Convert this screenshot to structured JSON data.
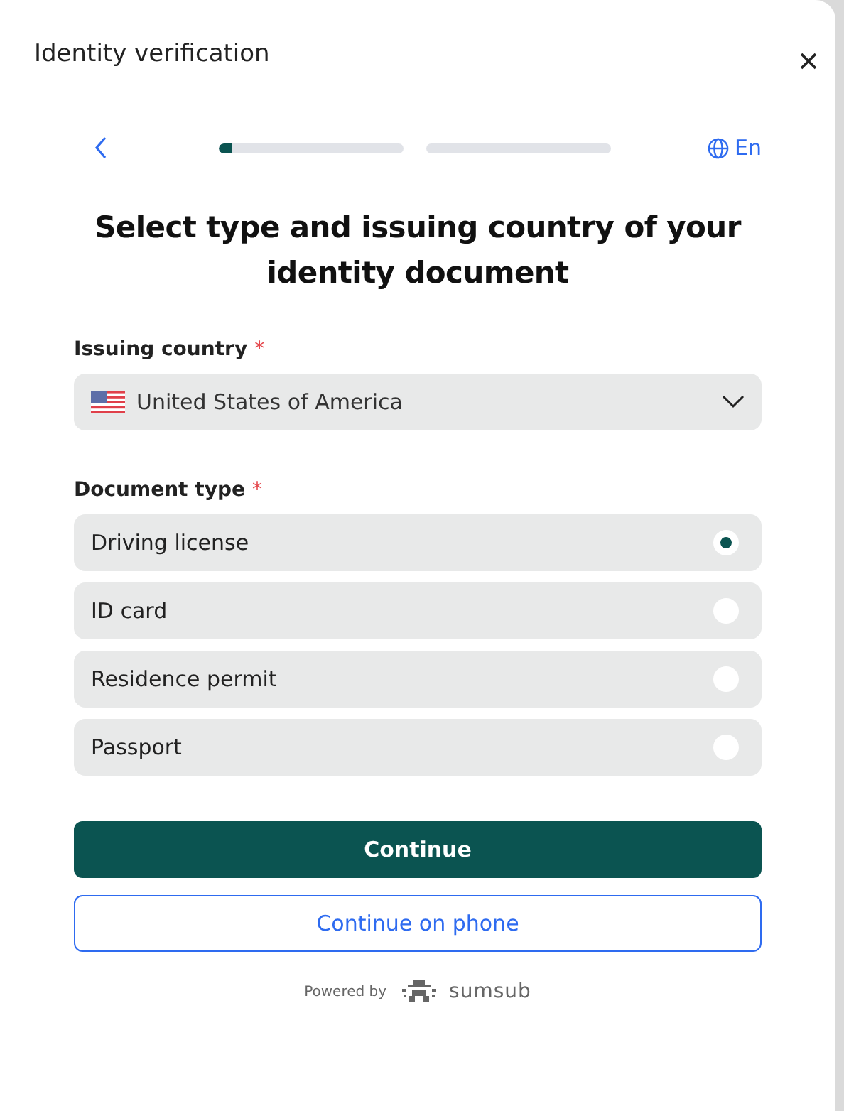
{
  "window": {
    "title": "Identity verification"
  },
  "progress": [
    {
      "level": 0.07
    },
    {
      "level": 0
    }
  ],
  "language": "En",
  "heading": "Select type and issuing country of your identity document",
  "country": {
    "label": "Issuing country",
    "required_mark": "*",
    "value": "United States of America"
  },
  "document_type": {
    "label": "Document type",
    "required_mark": "*",
    "options": [
      {
        "label": "Driving license",
        "selected": true
      },
      {
        "label": "ID card",
        "selected": false
      },
      {
        "label": "Residence permit",
        "selected": false
      },
      {
        "label": "Passport",
        "selected": false
      }
    ]
  },
  "buttons": [
    {
      "kind": "primary",
      "label": "Continue"
    },
    {
      "kind": "outline",
      "label": "Continue on phone"
    }
  ],
  "footer": {
    "powered_by": "Powered by",
    "brand": "sumsub"
  }
}
